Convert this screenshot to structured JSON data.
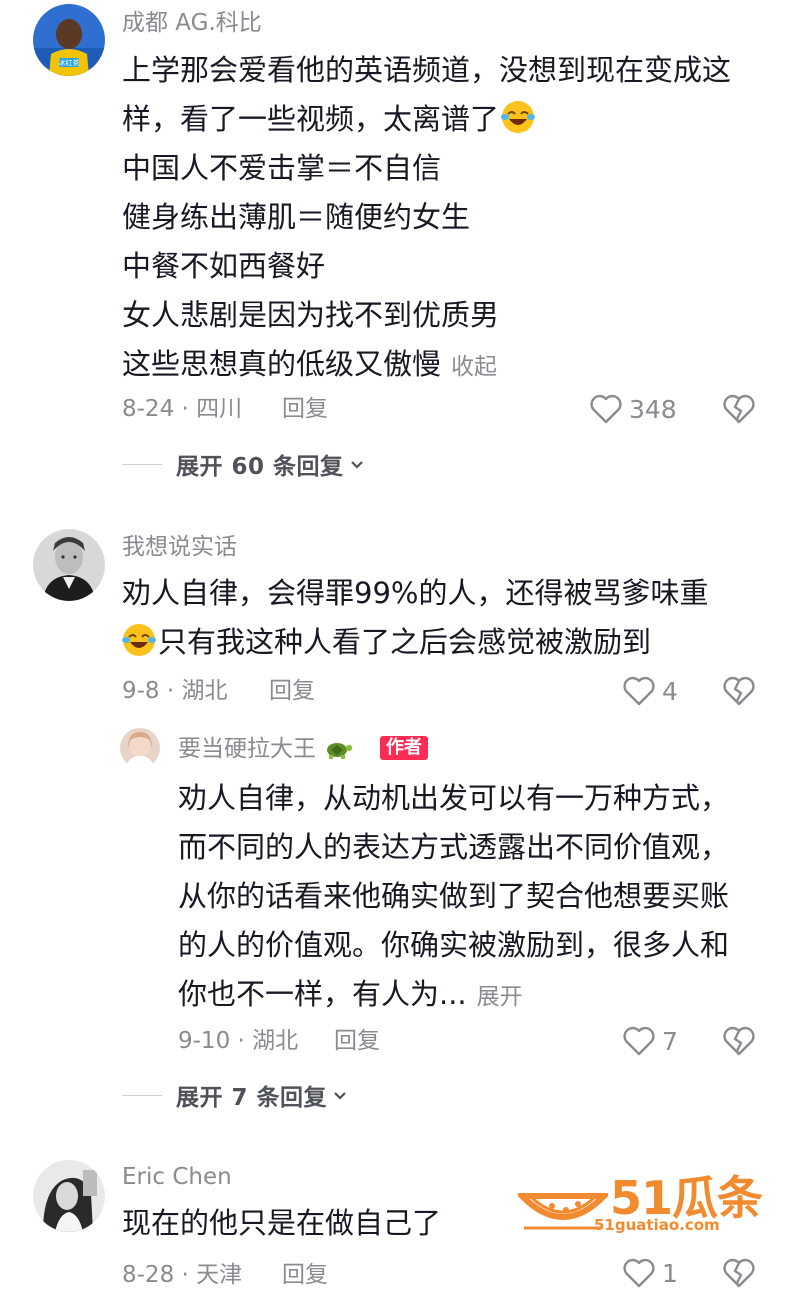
{
  "comments": [
    {
      "username": "成都 AG.科比",
      "lines": [
        "上学那会爱看他的英语频道，没想到现在变成这",
        "样，看了一些视频，太离谱了",
        "中国人不爱击掌＝不自信",
        "健身练出薄肌＝随便约女生",
        "中餐不如西餐好",
        "女人悲剧是因为找不到优质男",
        "这些思想真的低级又傲慢"
      ],
      "collapse_label": "收起",
      "date_location": "8-24 · 四川",
      "reply_label": "回复",
      "likes": "348",
      "expand_label": "展开 60 条回复"
    },
    {
      "username": "我想说实话",
      "lines": [
        "劝人自律，会得罪99%的人，还得被骂爹味重",
        "只有我这种人看了之后会感觉被激励到"
      ],
      "date_location": "9-8 · 湖北",
      "reply_label": "回复",
      "likes": "4",
      "reply": {
        "username": "要当硬拉大王",
        "author_badge": "作者",
        "lines": [
          "劝人自律，从动机出发可以有一万种方式，",
          "而不同的人的表达方式透露出不同价值观，",
          "从你的话看来他确实做到了契合他想要买账",
          "的人的价值观。你确实被激励到，很多人和",
          "你也不一样，有人为..."
        ],
        "more_label": "展开",
        "date_location": "9-10 · 湖北",
        "reply_label": "回复",
        "likes": "7"
      },
      "expand_label": "展开 7 条回复"
    },
    {
      "username": "Eric Chen",
      "lines": [
        "现在的他只是在做自己了"
      ],
      "date_location": "8-28 · 天津",
      "reply_label": "回复",
      "likes": "1"
    }
  ],
  "watermark": {
    "title": "51瓜条",
    "url": "51guatiao.com"
  },
  "colors": {
    "text": "#161823",
    "secondary": "#8a8b91",
    "author_badge": "#fe2c55",
    "watermark": "#f28b2f"
  }
}
